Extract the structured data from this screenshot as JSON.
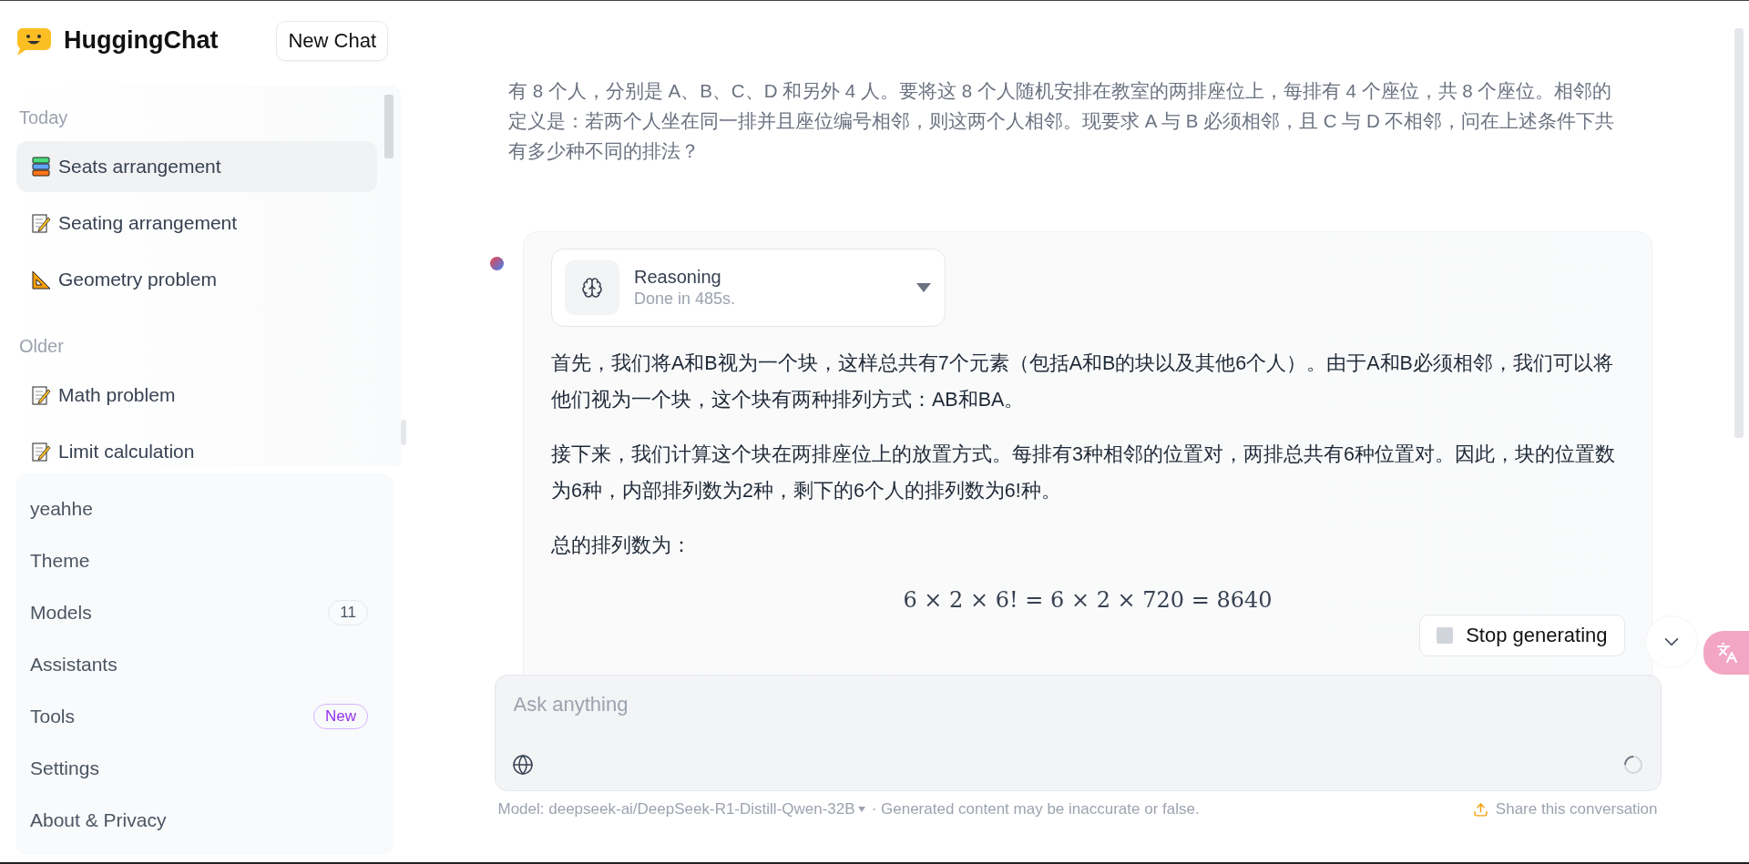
{
  "brand": {
    "name": "HuggingChat"
  },
  "new_chat_button": "New Chat",
  "conversation_groups": [
    {
      "heading": "Today",
      "items": [
        {
          "label": "Seats arrangement",
          "kind": "books",
          "selected": true
        },
        {
          "label": "Seating arrangement",
          "kind": "memo",
          "selected": false
        },
        {
          "label": "Geometry problem",
          "kind": "ruler",
          "selected": false
        }
      ]
    },
    {
      "heading": "Older",
      "items": [
        {
          "label": "Math problem",
          "kind": "memo",
          "selected": false
        },
        {
          "label": "Limit calculation",
          "kind": "memo",
          "selected": false
        }
      ]
    }
  ],
  "menu": [
    {
      "label": "yeahhe"
    },
    {
      "label": "Theme"
    },
    {
      "label": "Models",
      "badge": {
        "kind": "count",
        "text": "11"
      }
    },
    {
      "label": "Assistants"
    },
    {
      "label": "Tools",
      "badge": {
        "kind": "new",
        "text": "New"
      }
    },
    {
      "label": "Settings"
    },
    {
      "label": "About & Privacy"
    }
  ],
  "question": "有 8 个人，分别是 A、B、C、D 和另外 4 人。要将这 8 个人随机安排在教室的两排座位上，每排有 4 个座位，共 8 个座位。相邻的定义是：若两个人坐在同一排并且座位编号相邻，则这两个人相邻。现要求 A 与 B 必须相邻，且 C 与 D 不相邻，问在上述条件下共有多少种不同的排法？",
  "reasoning": {
    "title": "Reasoning",
    "status": "Done in 485s.",
    "expanded": false
  },
  "answer": {
    "paragraphs": [
      "首先，我们将A和B视为一个块，这样总共有7个元素（包括A和B的块以及其他6个人）。由于A和B必须相邻，我们可以将他们视为一个块，这个块有两种排列方式：AB和BA。",
      "接下来，我们计算这个块在两排座位上的放置方式。每排有3种相邻的位置对，两排总共有6种位置对。因此，块的位置数为6种，内部排列数为2种，剩下的6个人的排列数为6!种。",
      "总的排列数为："
    ],
    "formula": "6 × 2 × 6! = 6 × 2 × 720 = 8640"
  },
  "stop_button": "Stop generating",
  "input": {
    "placeholder": "Ask anything"
  },
  "footer": {
    "model": "Model: deepseek-ai/DeepSeek-R1-Distill-Qwen-32B",
    "note": "· Generated content may be inaccurate or false.",
    "share": "Share this conversation"
  }
}
